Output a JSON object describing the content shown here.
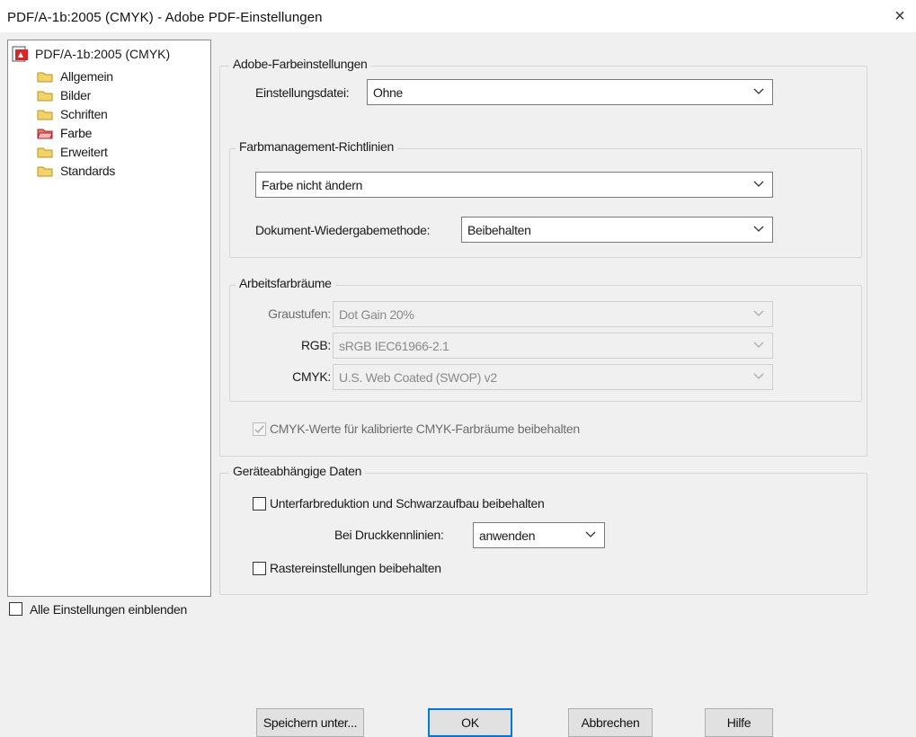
{
  "window": {
    "title": "PDF/A-1b:2005 (CMYK) - Adobe PDF-Einstellungen",
    "close_icon": "×"
  },
  "tree": {
    "root": "PDF/A-1b:2005 (CMYK)",
    "items": [
      {
        "label": "Allgemein",
        "icon": "folder-icon"
      },
      {
        "label": "Bilder",
        "icon": "folder-icon"
      },
      {
        "label": "Schriften",
        "icon": "folder-icon"
      },
      {
        "label": "Farbe",
        "icon": "folder-open-red-icon",
        "selected": true
      },
      {
        "label": "Erweitert",
        "icon": "folder-icon"
      },
      {
        "label": "Standards",
        "icon": "folder-icon"
      }
    ]
  },
  "show_all": {
    "label": "Alle Einstellungen einblenden",
    "checked": false
  },
  "adobe_color": {
    "group_label": "Adobe-Farbeinstellungen",
    "settings_file_label": "Einstellungsdatei:",
    "settings_file_value": "Ohne"
  },
  "policies": {
    "group_label": "Farbmanagement-Richtlinien",
    "policy_value": "Farbe nicht ändern",
    "rendering_label": "Dokument-Wiedergabemethode:",
    "rendering_value": "Beibehalten"
  },
  "working_spaces": {
    "group_label": "Arbeitsfarbräume",
    "gray_label": "Graustufen:",
    "gray_value": "Dot Gain 20%",
    "rgb_label": "RGB:",
    "rgb_value": "sRGB IEC61966-2.1",
    "cmyk_label": "CMYK:",
    "cmyk_value": "U.S. Web Coated (SWOP) v2"
  },
  "preserve_cmyk": {
    "label": "CMYK-Werte für kalibrierte CMYK-Farbräume beibehalten",
    "checked": true,
    "enabled": false
  },
  "device_data": {
    "group_label": "Geräteabhängige Daten",
    "ucr_label": "Unterfarbreduktion und Schwarzaufbau beibehalten",
    "ucr_checked": false,
    "transfer_label": "Bei Druckkennlinien:",
    "transfer_value": "anwenden",
    "halftone_label": "Rastereinstellungen beibehalten",
    "halftone_checked": false
  },
  "buttons": {
    "save_as": "Speichern unter...",
    "ok": "OK",
    "cancel": "Abbrechen",
    "help": "Hilfe"
  },
  "colors": {
    "default_button_border": "#0078d7",
    "pdf_icon_red": "#d9262b"
  }
}
